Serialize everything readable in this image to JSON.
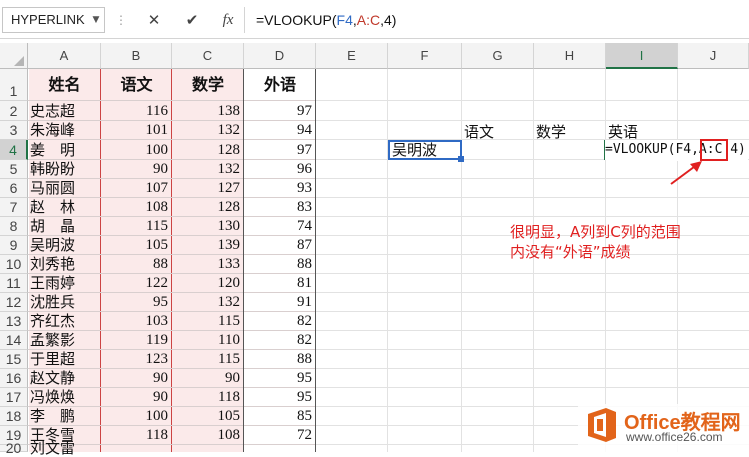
{
  "formula_bar": {
    "name_box": "HYPERLINK",
    "cancel_glyph": "✕",
    "enter_glyph": "✔",
    "fx_glyph": "fx",
    "formula_prefix": "=VLOOKUP(",
    "formula_ref1": "F4",
    "formula_comma1": ",",
    "formula_ref2": "A:C",
    "formula_suffix": ",4)"
  },
  "columns": [
    "A",
    "B",
    "C",
    "D",
    "E",
    "F",
    "G",
    "H",
    "I",
    "J"
  ],
  "rows": [
    "1",
    "2",
    "3",
    "4",
    "5",
    "6",
    "7",
    "8",
    "9",
    "10",
    "11",
    "12",
    "13",
    "14",
    "15",
    "16",
    "17",
    "18",
    "19",
    "20"
  ],
  "headers": {
    "name": "姓名",
    "chinese": "语文",
    "math": "数学",
    "english": "外语"
  },
  "students": [
    {
      "name": "史志超",
      "chinese": "116",
      "math": "138",
      "english": "97"
    },
    {
      "name": "朱海峰",
      "chinese": "101",
      "math": "132",
      "english": "94"
    },
    {
      "name": "姜　明",
      "chinese": "100",
      "math": "128",
      "english": "97"
    },
    {
      "name": "韩盼盼",
      "chinese": "90",
      "math": "132",
      "english": "96"
    },
    {
      "name": "马丽圆",
      "chinese": "107",
      "math": "127",
      "english": "93"
    },
    {
      "name": "赵　林",
      "chinese": "108",
      "math": "128",
      "english": "83"
    },
    {
      "name": "胡　晶",
      "chinese": "115",
      "math": "130",
      "english": "74"
    },
    {
      "name": "吴明波",
      "chinese": "105",
      "math": "139",
      "english": "87"
    },
    {
      "name": "刘秀艳",
      "chinese": "88",
      "math": "133",
      "english": "88"
    },
    {
      "name": "王雨婷",
      "chinese": "122",
      "math": "120",
      "english": "81"
    },
    {
      "name": "沈胜兵",
      "chinese": "95",
      "math": "132",
      "english": "91"
    },
    {
      "name": "齐红杰",
      "chinese": "103",
      "math": "115",
      "english": "82"
    },
    {
      "name": "孟繁影",
      "chinese": "119",
      "math": "110",
      "english": "82"
    },
    {
      "name": "于里超",
      "chinese": "123",
      "math": "115",
      "english": "88"
    },
    {
      "name": "赵文静",
      "chinese": "90",
      "math": "90",
      "english": "95"
    },
    {
      "name": "冯焕焕",
      "chinese": "90",
      "math": "118",
      "english": "95"
    },
    {
      "name": "李　鹏",
      "chinese": "100",
      "math": "105",
      "english": "85"
    },
    {
      "name": "王冬雪",
      "chinese": "118",
      "math": "108",
      "english": "72"
    },
    {
      "name": "刘文雷",
      "chinese": "",
      "math": "",
      "english": ""
    }
  ],
  "lookup": {
    "g3": "语文",
    "h3": "数学",
    "i3": "英语",
    "f4": "吴明波",
    "i4_prefix": "=VLOOKUP(F4,",
    "i4_ref": "A:C",
    "i4_suffix": " 4)"
  },
  "annotation": {
    "line1": "很明显，A列到C列的范围",
    "line2": "内没有“外语”成绩"
  },
  "logo": {
    "title": "Office教程网",
    "url": "www.office26.com"
  },
  "colors": {
    "accent_green": "#217346",
    "ref_blue": "#2f6ac4",
    "annotation_red": "#e02020",
    "header_pink": "#fbeaea",
    "logo_orange": "#e2641a"
  }
}
